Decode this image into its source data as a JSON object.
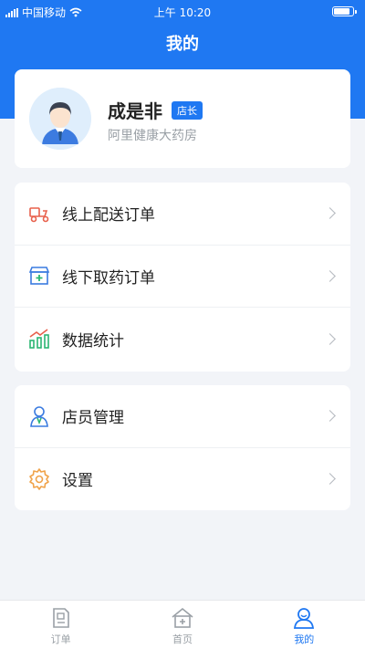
{
  "status_bar": {
    "carrier": "中国移动",
    "time": "上午 10:20"
  },
  "nav": {
    "title": "我的"
  },
  "profile": {
    "name": "成是非",
    "role": "店长",
    "store": "阿里健康大药房"
  },
  "menu_group_1": [
    {
      "label": "线上配送订单",
      "icon": "delivery-scooter-icon"
    },
    {
      "label": "线下取药订单",
      "icon": "pharmacy-store-icon"
    },
    {
      "label": "数据统计",
      "icon": "bar-chart-icon"
    }
  ],
  "menu_group_2": [
    {
      "label": "店员管理",
      "icon": "staff-user-icon"
    },
    {
      "label": "设置",
      "icon": "gear-icon"
    }
  ],
  "tabs": [
    {
      "label": "订单",
      "icon": "order-icon",
      "active": false
    },
    {
      "label": "首页",
      "icon": "home-icon",
      "active": false
    },
    {
      "label": "我的",
      "icon": "profile-icon",
      "active": true
    }
  ],
  "colors": {
    "primary": "#1f78f2",
    "background": "#f2f4f8",
    "red_icon": "#e8604c",
    "blue_icon": "#3a7be0",
    "green_icon": "#2bb673",
    "orange_icon": "#f0a34a"
  }
}
